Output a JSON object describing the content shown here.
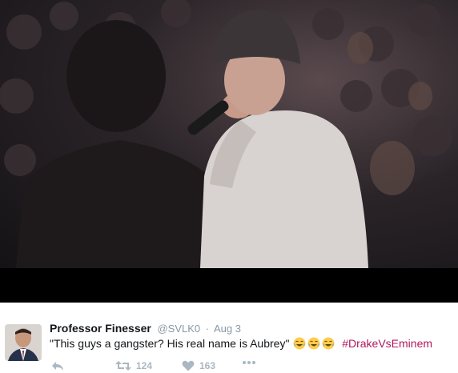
{
  "media": {
    "image_description": ""
  },
  "tweet": {
    "author": {
      "full_name": "Professor Finesser",
      "handle": "@SVLK0"
    },
    "date": "Aug 3",
    "separator": "·",
    "text": "\"This guys a gangster? His real name is Aubrey\"",
    "emojis": [
      "crying-laughing-emoji",
      "crying-laughing-emoji",
      "crying-laughing-emoji"
    ],
    "hashtag": "#DrakeVsEminem",
    "actions": {
      "reply_icon": "reply-icon",
      "retweet_count": "124",
      "like_count": "163",
      "more_icon": "more-icon"
    }
  },
  "colors": {
    "hashtag": "#b0185d",
    "meta": "#8899a6",
    "action": "#aab8c2"
  }
}
